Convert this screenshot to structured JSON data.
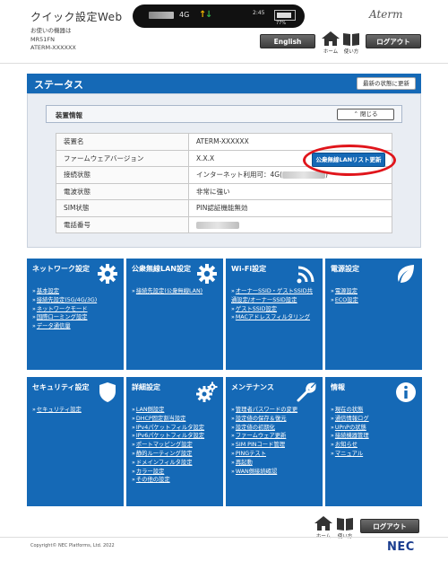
{
  "header": {
    "title": "クイック設定Web",
    "device_label": "お使いの機器は",
    "device_model": "MR51FN",
    "device_id": "ATERM-XXXXXX",
    "logo": "Aterm",
    "status": {
      "network": "4G",
      "time": "2:45",
      "battery": "77%"
    },
    "english_btn": "English",
    "home_label": "ホーム",
    "howto_label": "使い方",
    "logout_btn": "ログアウト"
  },
  "status_section": {
    "title": "ステータス",
    "refresh_btn": "最新の状態に更新",
    "panel_title": "装置情報",
    "close_btn": "閉じる",
    "public_btn": "公衆無線LANリスト更新",
    "rows": [
      {
        "key": "装置名",
        "value": "ATERM-XXXXXX"
      },
      {
        "key": "ファームウェアバージョン",
        "value": "X.X.X"
      },
      {
        "key": "接続状態",
        "value": "インターネット利用可：4G("
      },
      {
        "key": "電波状態",
        "value": "非常に強い"
      },
      {
        "key": "SIM状態",
        "value": "PIN認証機能無効"
      },
      {
        "key": "電話番号",
        "value": ""
      }
    ]
  },
  "tiles": [
    {
      "title": "ネットワーク設定",
      "icon": "gear-icon",
      "links": [
        "基本設定",
        "接続先設定(5G/4G/3G)",
        "ネットワークモード",
        "国際ローミング設定",
        "データ通信量"
      ]
    },
    {
      "title": "公衆無線LAN設定",
      "icon": "gear-icon",
      "links": [
        "接続先設定(公衆無線LAN)"
      ]
    },
    {
      "title": "Wi-Fi設定",
      "icon": "wifi-icon",
      "links": [
        "オーナーSSID・ゲストSSID共通設定/オーナーSSID設定",
        "ゲストSSID設定",
        "MACアドレスフィルタリング"
      ]
    },
    {
      "title": "電源設定",
      "icon": "leaf-icon",
      "links": [
        "電源設定",
        "ECO設定"
      ]
    },
    {
      "title": "セキュリティ設定",
      "icon": "shield-icon",
      "links": [
        "セキュリティ設定"
      ]
    },
    {
      "title": "詳細設定",
      "icon": "gears-icon",
      "links": [
        "LAN側設定",
        "DHCP固定割当設定",
        "IPv4パケットフィルタ設定",
        "IPv6パケットフィルタ設定",
        "ポートマッピング設定",
        "静的ルーティング設定",
        "ドメインフィルタ設定",
        "カラー設定",
        "その他の設定"
      ]
    },
    {
      "title": "メンテナンス",
      "icon": "wrench-icon",
      "links": [
        "管理者パスワードの変更",
        "設定値の保存＆復元",
        "設定値の初期化",
        "ファームウェア更新",
        "SIM PINコード管理",
        "PINGテスト",
        "再起動",
        "WAN側接続確認"
      ]
    },
    {
      "title": "情報",
      "icon": "info-icon",
      "links": [
        "現在の状態",
        "通信情報ログ",
        "UPnPの状態",
        "接続機器管理",
        "お知らせ",
        "マニュアル"
      ]
    }
  ],
  "footer": {
    "copyright": "Copyright© NEC Platforms, Ltd. 2022",
    "brand": "NEC"
  },
  "colors": {
    "primary": "#1569b6",
    "highlight": "#e0151b"
  }
}
